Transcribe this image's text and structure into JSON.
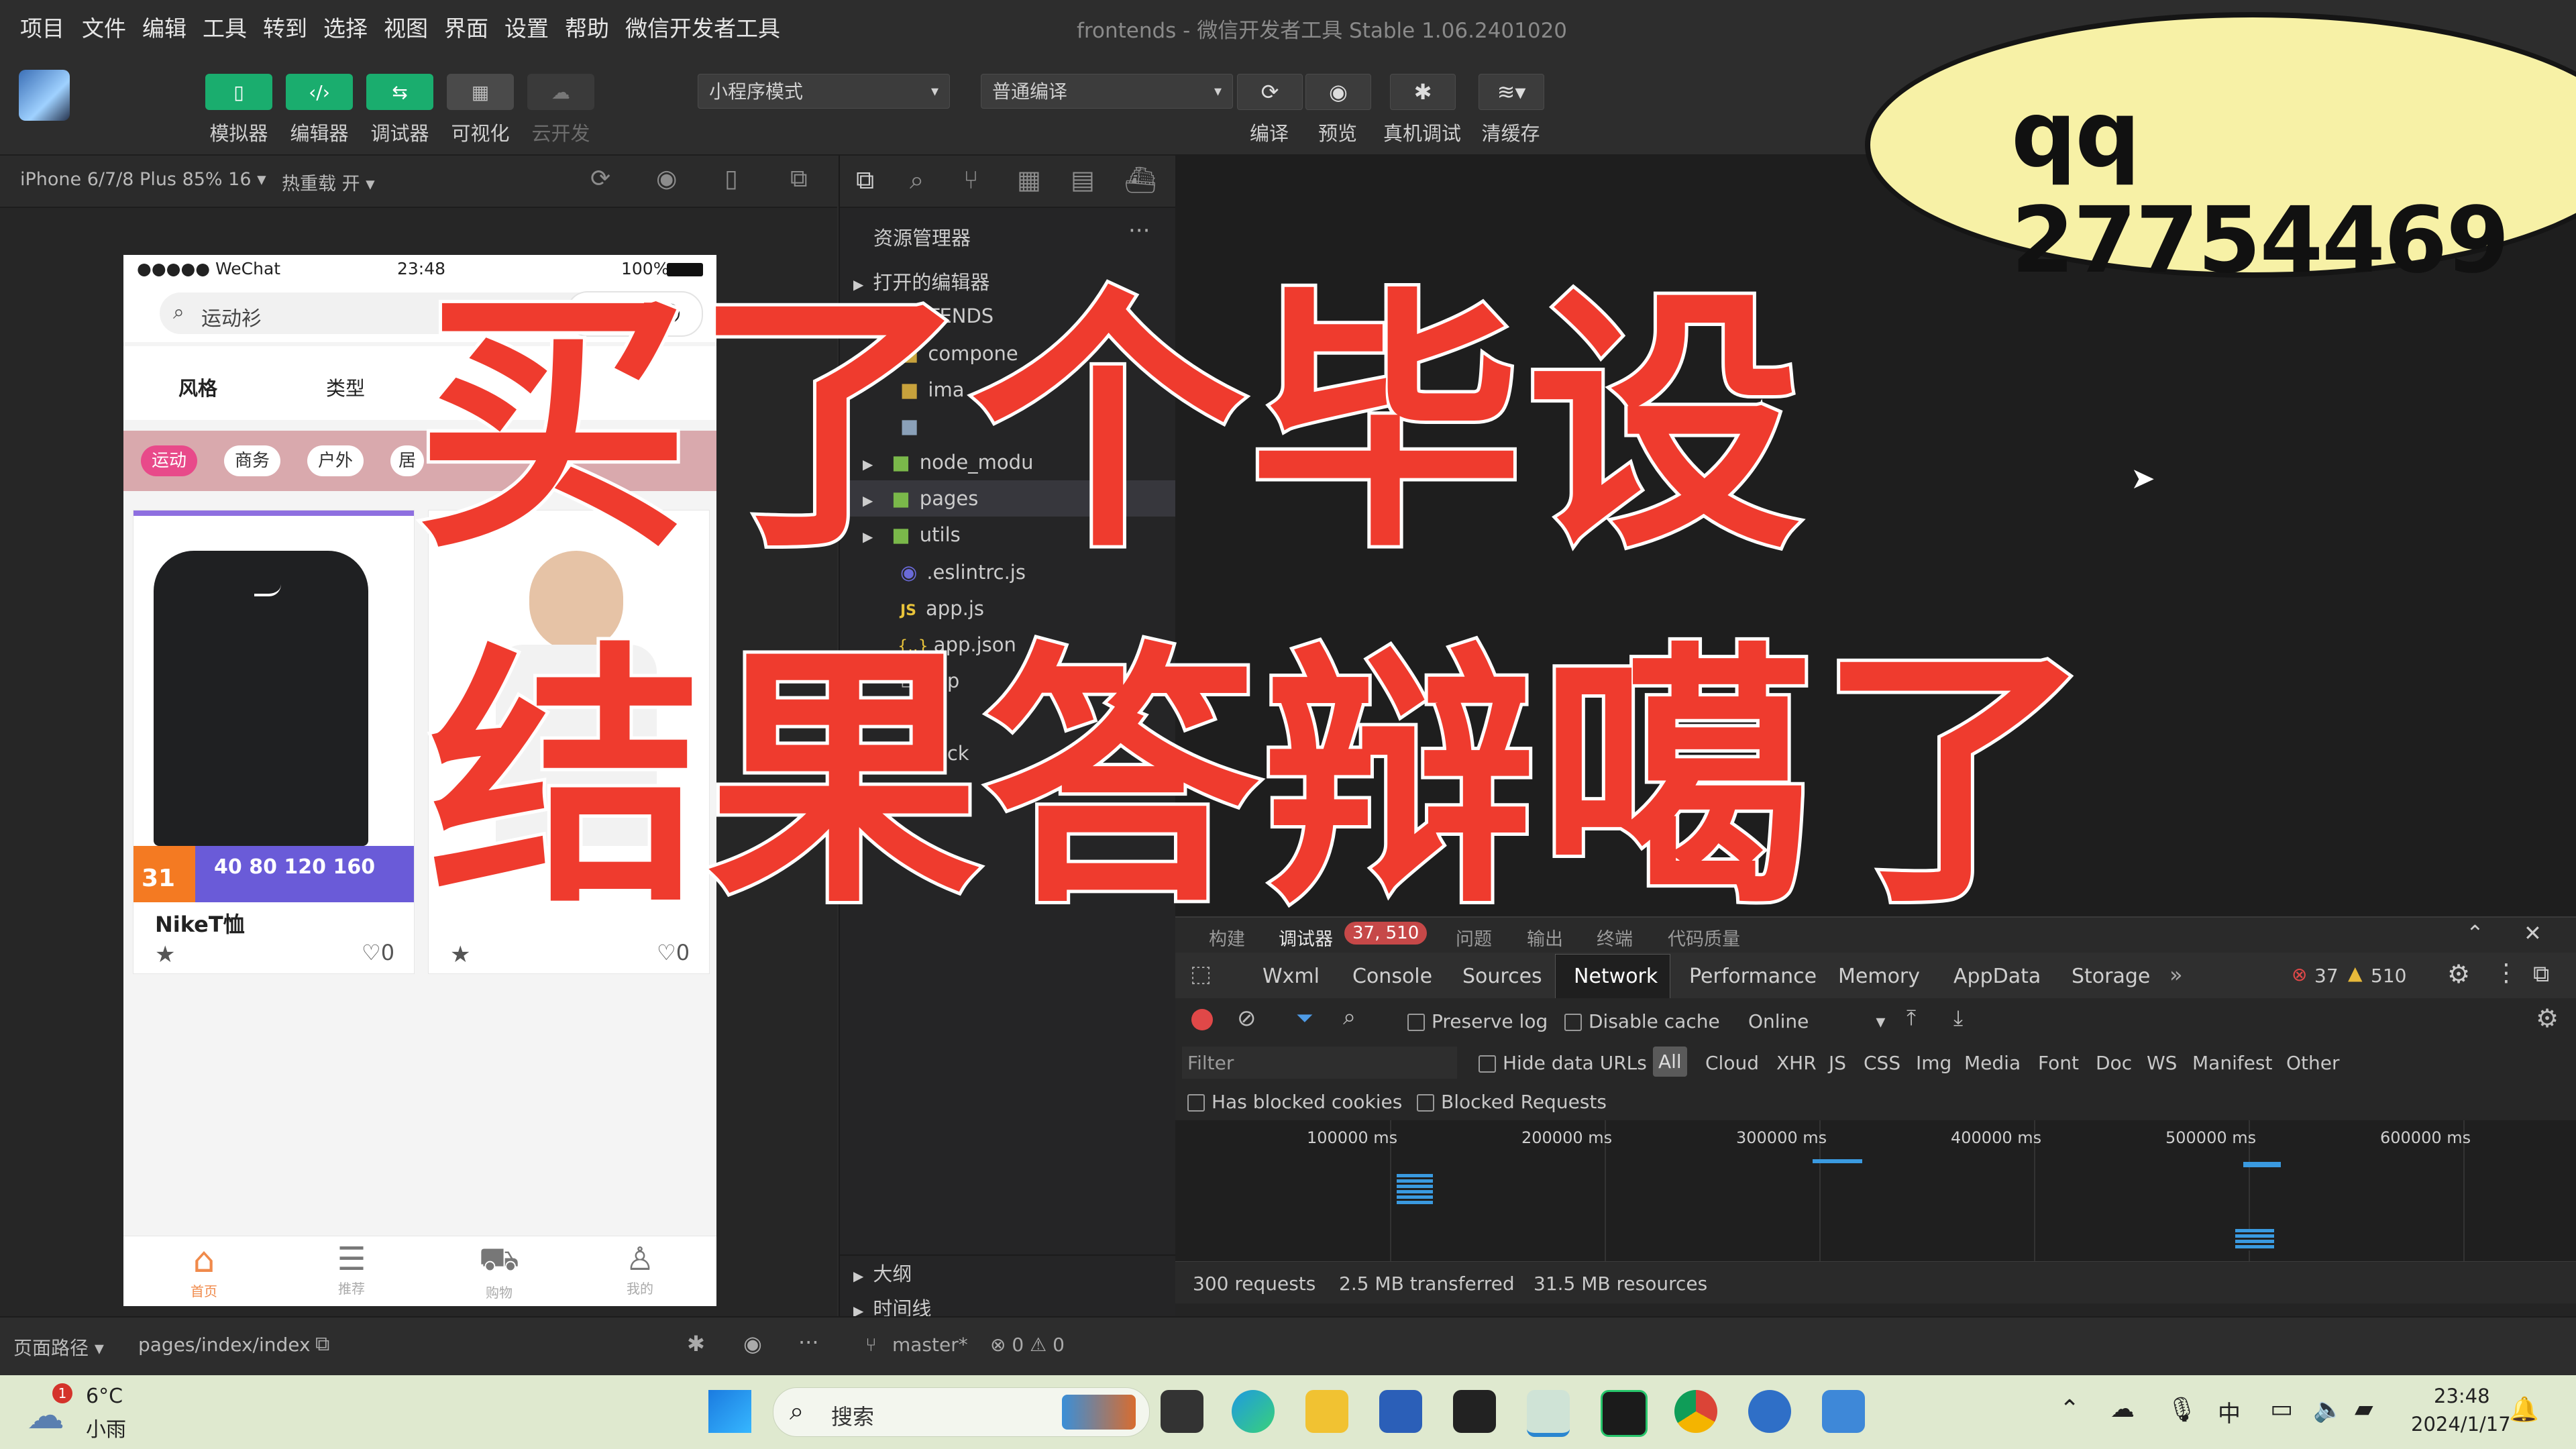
{
  "menubar": {
    "items": [
      "项目",
      "文件",
      "编辑",
      "工具",
      "转到",
      "选择",
      "视图",
      "界面",
      "设置",
      "帮助",
      "微信开发者工具"
    ],
    "window_title": "frontends - 微信开发者工具 Stable 1.06.2401020"
  },
  "toolbar": {
    "buttons": [
      {
        "label": "模拟器",
        "icon": "phone-icon"
      },
      {
        "label": "编辑器",
        "icon": "code-icon"
      },
      {
        "label": "调试器",
        "icon": "debug-icon"
      },
      {
        "label": "可视化",
        "icon": "grid-icon"
      },
      {
        "label": "云开发",
        "icon": "cloud-icon"
      }
    ],
    "mode_select": "小程序模式",
    "compile_select": "普通编译",
    "right_buttons": [
      {
        "label": "编译",
        "icon": "refresh-icon"
      },
      {
        "label": "预览",
        "icon": "eye-icon"
      },
      {
        "label": "真机调试",
        "icon": "bug-icon"
      },
      {
        "label": "清缓存",
        "icon": "layers-icon"
      }
    ]
  },
  "simulator": {
    "device": "iPhone 6/7/8 Plus 85% 16 ▾",
    "hot_reload": "热重载 开 ▾",
    "status": {
      "carrier": "●●●●● WeChat",
      "time": "23:48",
      "battery": "100%"
    },
    "search_placeholder": "运动衫",
    "search_button": "搜索",
    "filter_tabs": [
      "风格",
      "类型"
    ],
    "tags": [
      "运动",
      "商务",
      "户外",
      "居"
    ],
    "products": [
      {
        "title": "NikeT恤",
        "likes": "0",
        "badge": "31"
      },
      {
        "title": "",
        "likes": "0",
        "badge": ""
      }
    ],
    "price_strip": "40 80 120 160",
    "tabbar": [
      "首页",
      "推荐",
      "购物",
      "我的"
    ]
  },
  "explorer": {
    "title": "资源管理器",
    "sections": [
      "打开的编辑器",
      "FRONTENDS"
    ],
    "files": [
      {
        "name": "compone",
        "type": "folder",
        "badge": "4"
      },
      {
        "name": "ima",
        "type": "folder"
      },
      {
        "name": "",
        "type": "folder"
      },
      {
        "name": "node_modu",
        "type": "folder"
      },
      {
        "name": "pages",
        "type": "folder"
      },
      {
        "name": "utils",
        "type": "folder"
      },
      {
        "name": ".eslintrc.js",
        "type": "file"
      },
      {
        "name": "app.js",
        "type": "js"
      },
      {
        "name": "app.json",
        "type": "json"
      },
      {
        "name": "app",
        "type": "file"
      },
      {
        "name": "pack",
        "type": "file"
      }
    ],
    "bottom_sections": [
      "大纲",
      "时间线"
    ]
  },
  "devtools": {
    "top_tabs": [
      "构建",
      "调试器",
      "问题",
      "输出",
      "终端",
      "代码质量"
    ],
    "debugger_badge": "37, 510",
    "panel_tabs": [
      "Wxml",
      "Console",
      "Sources",
      "Network",
      "Performance",
      "Memory",
      "AppData",
      "Storage"
    ],
    "active_tab": "Network",
    "errors": "37",
    "warnings": "510",
    "preserve_log": "Preserve log",
    "disable_cache": "Disable cache",
    "throttle": "Online",
    "filter_placeholder": "Filter",
    "hide_data_urls": "Hide data URLs",
    "type_filters": [
      "All",
      "Cloud",
      "XHR",
      "JS",
      "CSS",
      "Img",
      "Media",
      "Font",
      "Doc",
      "WS",
      "Manifest",
      "Other"
    ],
    "has_blocked_cookies": "Has blocked cookies",
    "blocked_requests": "Blocked Requests",
    "timeline_ticks": [
      "100000 ms",
      "200000 ms",
      "300000 ms",
      "400000 ms",
      "500000 ms",
      "600000 ms"
    ],
    "summary": {
      "requests": "300 requests",
      "transferred": "2.5 MB transferred",
      "resources": "31.5 MB resources"
    }
  },
  "statusbar": {
    "path_label": "页面路径 ▾",
    "path": "pages/index/index",
    "branch": "master*",
    "problems": "⊗ 0 ⚠ 0"
  },
  "taskbar": {
    "weather_temp": "6°C",
    "weather_desc": "小雨",
    "weather_badge": "1",
    "search": "搜索",
    "ime": "中",
    "time": "23:48",
    "date": "2024/1/17"
  },
  "overlay": {
    "qq": "qq 27754469",
    "headline_line1": "买了个毕设",
    "headline_line2": "结果答辩噶了"
  },
  "colors": {
    "accent_green": "#1aad6e",
    "headline_red": "#ef3b2e",
    "bubble": "#f7f1a6",
    "taskbar": "#dfe9cf"
  }
}
